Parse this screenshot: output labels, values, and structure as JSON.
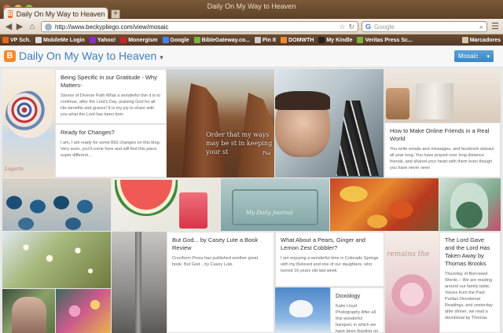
{
  "window": {
    "title": "Daily On My Way to Heaven"
  },
  "tab": {
    "label": "Daily On My Way to Heaven",
    "favicon": "blogger-icon"
  },
  "nav": {
    "url": "http://www.beckypliego.com/view/mosaic",
    "search_placeholder": "Google"
  },
  "bookmarks": [
    {
      "label": "VP Sch.",
      "icon": "vp-icon",
      "color": "#e06a1f"
    },
    {
      "label": "MobileMe Login",
      "icon": "apple-icon",
      "color": "#dddddd"
    },
    {
      "label": "Yahoo!",
      "icon": "yahoo-icon",
      "color": "#8b2fc9"
    },
    {
      "label": "Monergism",
      "icon": "monergism-icon",
      "color": "#c62828"
    },
    {
      "label": "Google",
      "icon": "google-icon",
      "color": "#4285f4"
    },
    {
      "label": "BibleGateway.co...",
      "icon": "biblegateway-icon",
      "color": "#7cb342"
    },
    {
      "label": "Pin It",
      "icon": "pinit-icon",
      "color": "#cccccc"
    },
    {
      "label": "DOMWTH",
      "icon": "blogger-bm-icon",
      "color": "#f38a2e"
    },
    {
      "label": "My Kindle",
      "icon": "kindle-icon",
      "color": "#222222"
    },
    {
      "label": "Veritas Press Sc...",
      "icon": "veritas-icon",
      "color": "#7cb342"
    },
    {
      "label": "Marcadores",
      "icon": "bookmarks-folder-icon",
      "color": "#d9c8a8"
    }
  ],
  "blog": {
    "title": "Daily On My Way to Heaven",
    "title_suffix": "▾",
    "view_button": "Mosaic",
    "view_caret": "▾"
  },
  "posts": {
    "gratitude": {
      "title": "Being Specific in our Gratitude - Why Matters-",
      "body": "Stones of Diverse Path What a wonderful thin it is to continue, after the Lord's Day, praising God for all His benefits and graces! It is my joy to share with you what the Lord has been doin"
    },
    "changes": {
      "title": "Ready for Changes?",
      "body": "I am, I am ready for some BIG changes on this blog. Very soon, you'll come here and will find this place super different..."
    },
    "online_friends": {
      "title": "How to Make Online Friends in a Real World",
      "body": "You write emails and messages, and facebook statues all year long. You have prayed over long distance friends, and shared your heart with them even though you have never seen"
    },
    "but_god": {
      "title": "But God... by Casey Lute a Book Review",
      "body": "Cruciform Press has published another great book. But God... by Casey Lute."
    },
    "pears": {
      "title": "What About a Pears, Ginger and Lemon Zest Cobbler?",
      "body": "I am enjoying a wonderful time in Colorado Springs with my Beloved and one of our daughters, who turned 16 years old last week."
    },
    "doxology": {
      "title": "Doxology",
      "body": "Katie Lloyd Photography After all this wonderful banquet, in which we have been feasting on"
    },
    "lord_gave": {
      "title": "The Lord Gave and the Lord Has Taken Away by Thomas Brooks",
      "body": "Thursday of Borrowed Words.-- We are reading around our family table, Voices from the Past: Puritan Devotional Readings, and yesterday after dinner, we read a devotional by Thomas"
    }
  },
  "photo_text": {
    "quote": "Order that my ways may be st in keeping your st",
    "quote_attrib": "Psa",
    "journal": "My Daily Journal",
    "remains": "remains the",
    "cake_label": "Lagarta"
  }
}
